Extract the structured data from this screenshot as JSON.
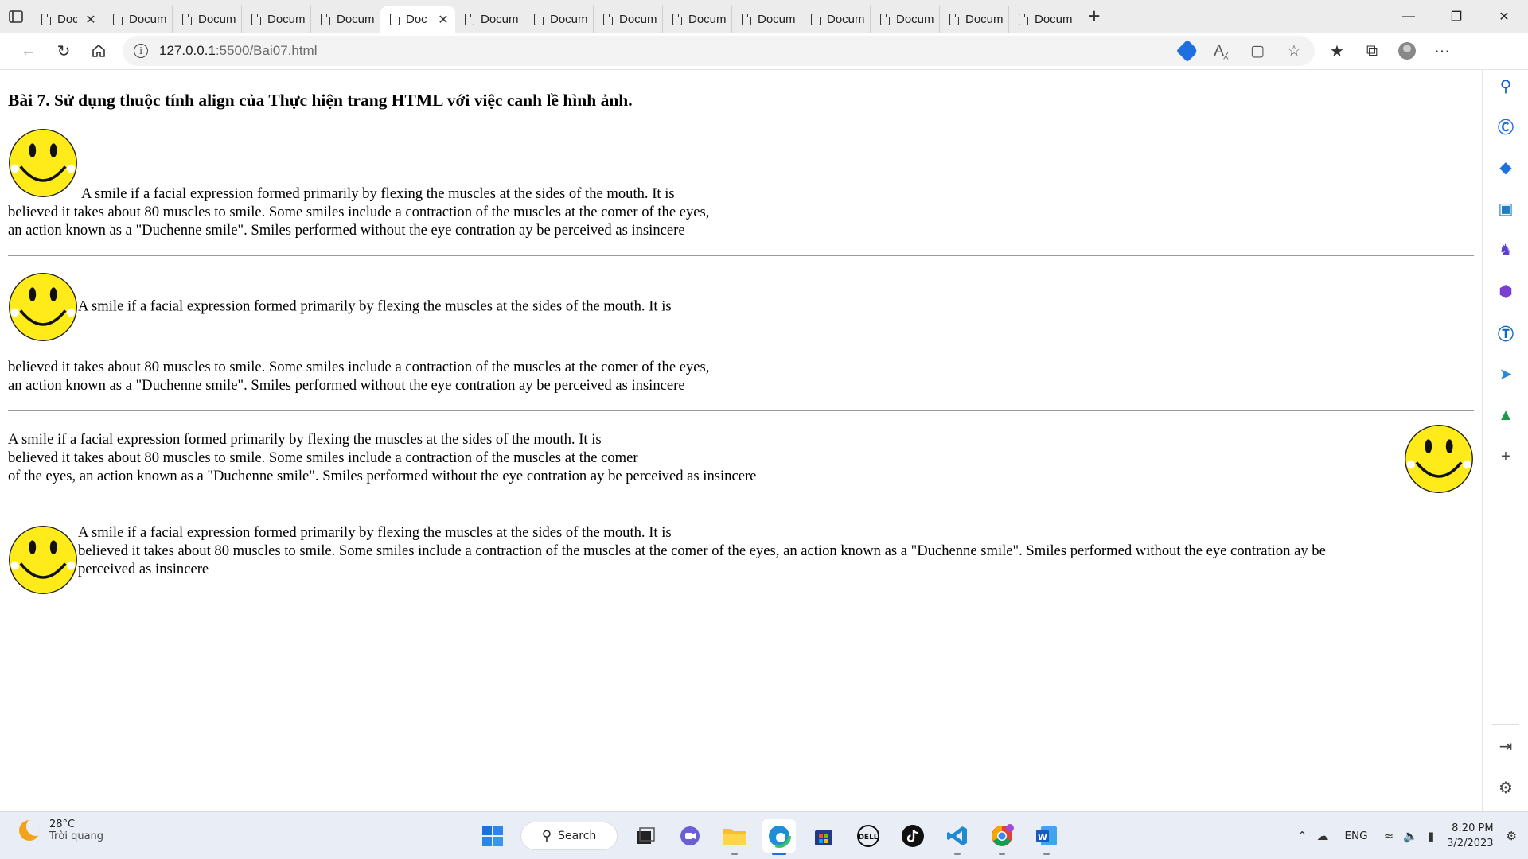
{
  "browser": {
    "tabs": [
      {
        "label": "Doc",
        "closable": true,
        "active": false
      },
      {
        "label": "Document",
        "closable": false,
        "active": false
      },
      {
        "label": "Document",
        "closable": false,
        "active": false
      },
      {
        "label": "Document",
        "closable": false,
        "active": false
      },
      {
        "label": "Document",
        "closable": false,
        "active": false
      },
      {
        "label": "Doc",
        "closable": true,
        "active": true
      },
      {
        "label": "Document",
        "closable": false,
        "active": false
      },
      {
        "label": "Document",
        "closable": false,
        "active": false
      },
      {
        "label": "Document",
        "closable": false,
        "active": false
      },
      {
        "label": "Document",
        "closable": false,
        "active": false
      },
      {
        "label": "Document",
        "closable": false,
        "active": false
      },
      {
        "label": "Document",
        "closable": false,
        "active": false
      },
      {
        "label": "Document",
        "closable": false,
        "active": false
      },
      {
        "label": "Document",
        "closable": false,
        "active": false
      },
      {
        "label": "Document",
        "closable": false,
        "active": false
      }
    ],
    "url_host": "127.0.0.1",
    "url_path": ":5500/Bai07.html"
  },
  "page": {
    "heading": "Bài 7. Sử dụng thuộc tính align của  Thực hiện trang HTML với việc canh lề hình ảnh.",
    "block1_line1": "A smile if a facial expression formed primarily by flexing the muscles at the sides of the mouth. It is",
    "block1_line2": "believed it takes about 80 muscles to smile. Some smiles include a contraction of the muscles at the comer of the eyes,",
    "block1_line3": "an action known as a \"Duchenne smile\". Smiles performed without the eye contration ay be perceived as insincere",
    "block2_line1": "A smile if a facial expression formed primarily by flexing the muscles at the sides of the mouth. It is",
    "block2_line2": "believed it takes about 80 muscles to smile. Some smiles include a contraction of the muscles at the comer of the eyes,",
    "block2_line3": "an action known as a \"Duchenne smile\". Smiles performed without the eye contration ay be perceived as insincere",
    "block3_line1": "A smile if a facial expression formed primarily by flexing the muscles at the sides of the mouth. It is",
    "block3_line2": "believed it takes about 80 muscles to smile. Some smiles include a contraction of the muscles at the comer",
    "block3_line3": "of the eyes, an action known as a \"Duchenne smile\". Smiles performed without the eye contration ay be perceived as insincere",
    "block4_line1": "A smile if a facial expression formed primarily by flexing the muscles at the sides of the mouth. It is",
    "block4_line2": "believed it takes about 80 muscles to smile. Some smiles include a contraction of the muscles at the comer of the eyes, an action known as a \"Duchenne smile\". Smiles performed without the eye contration ay be",
    "block4_line3": "perceived as insincere"
  },
  "taskbar": {
    "temperature": "28°C",
    "weather_text": "Trời quang",
    "search_label": "Search",
    "language": "ENG",
    "time": "8:20 PM",
    "date": "3/2/2023"
  },
  "colors": {
    "smiley_face": "#ffeb1a",
    "accent": "#1e6fe0"
  }
}
